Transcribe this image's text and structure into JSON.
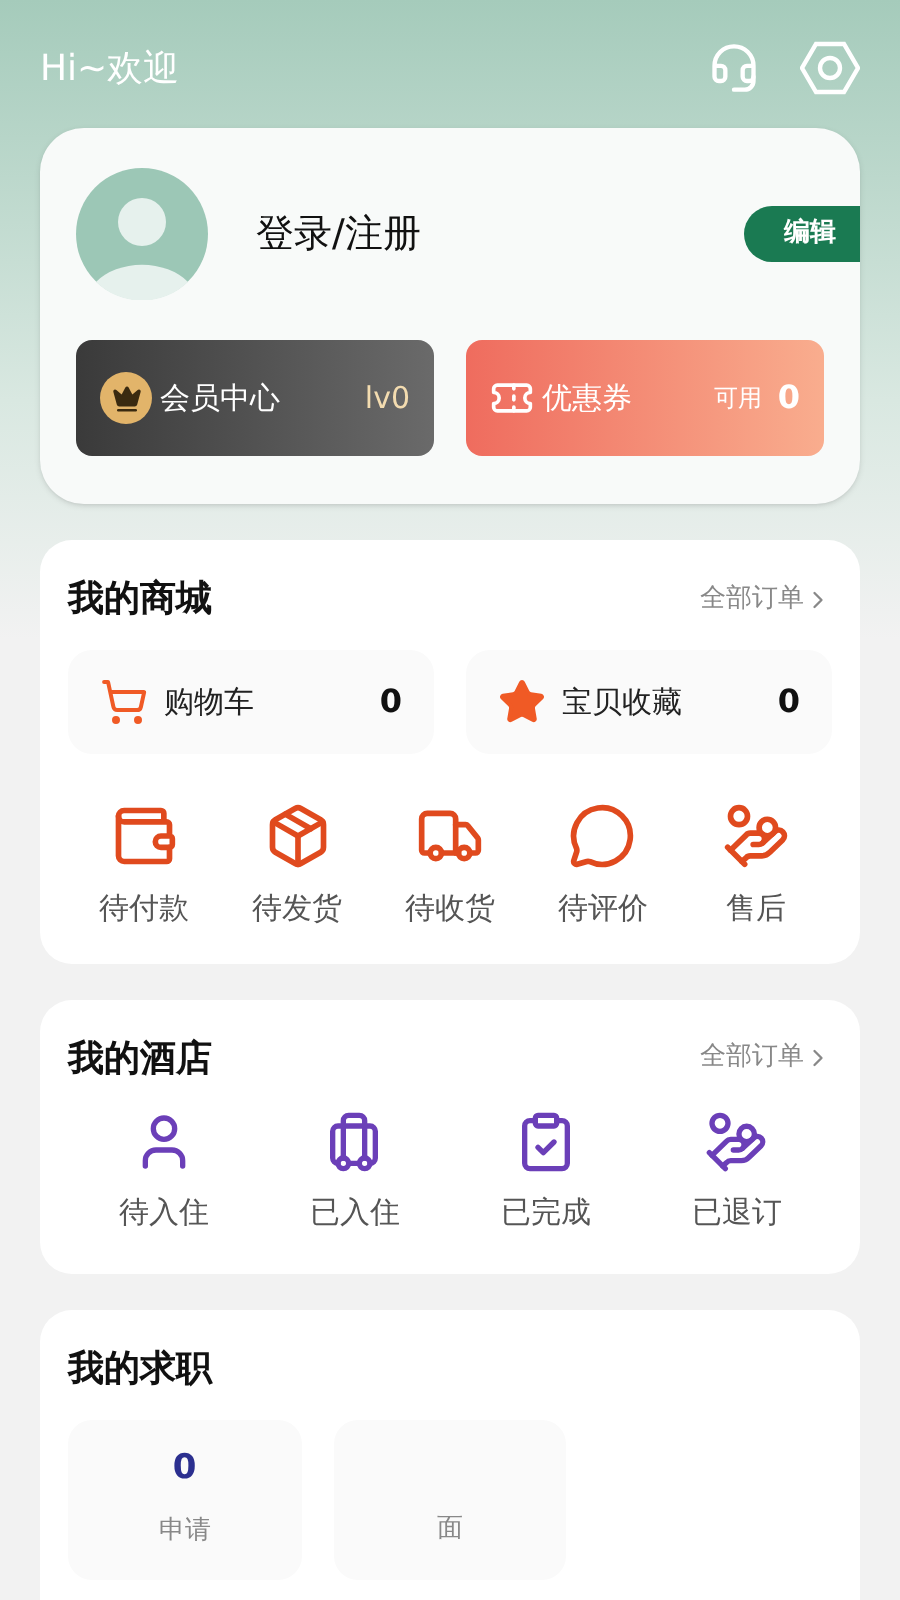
{
  "header": {
    "greeting": "Hi~欢迎"
  },
  "profile": {
    "login": "登录/注册",
    "edit": "编辑",
    "member": {
      "label": "会员中心",
      "level": "lv0"
    },
    "coupon": {
      "label": "优惠券",
      "available": "可用",
      "count": "0"
    }
  },
  "mall": {
    "title": "我的商城",
    "link": "全部订单",
    "counters": [
      {
        "label": "购物车",
        "count": "0"
      },
      {
        "label": "宝贝收藏",
        "count": "0"
      }
    ],
    "orders": [
      {
        "label": "待付款"
      },
      {
        "label": "待发货"
      },
      {
        "label": "待收货"
      },
      {
        "label": "待评价"
      },
      {
        "label": "售后"
      }
    ]
  },
  "hotel": {
    "title": "我的酒店",
    "link": "全部订单",
    "orders": [
      {
        "label": "待入住"
      },
      {
        "label": "已入住"
      },
      {
        "label": "已完成"
      },
      {
        "label": "已退订"
      }
    ]
  },
  "jobs": {
    "title": "我的求职",
    "stats": [
      {
        "value": "0",
        "label": "申请"
      },
      {
        "label": "面"
      }
    ]
  }
}
